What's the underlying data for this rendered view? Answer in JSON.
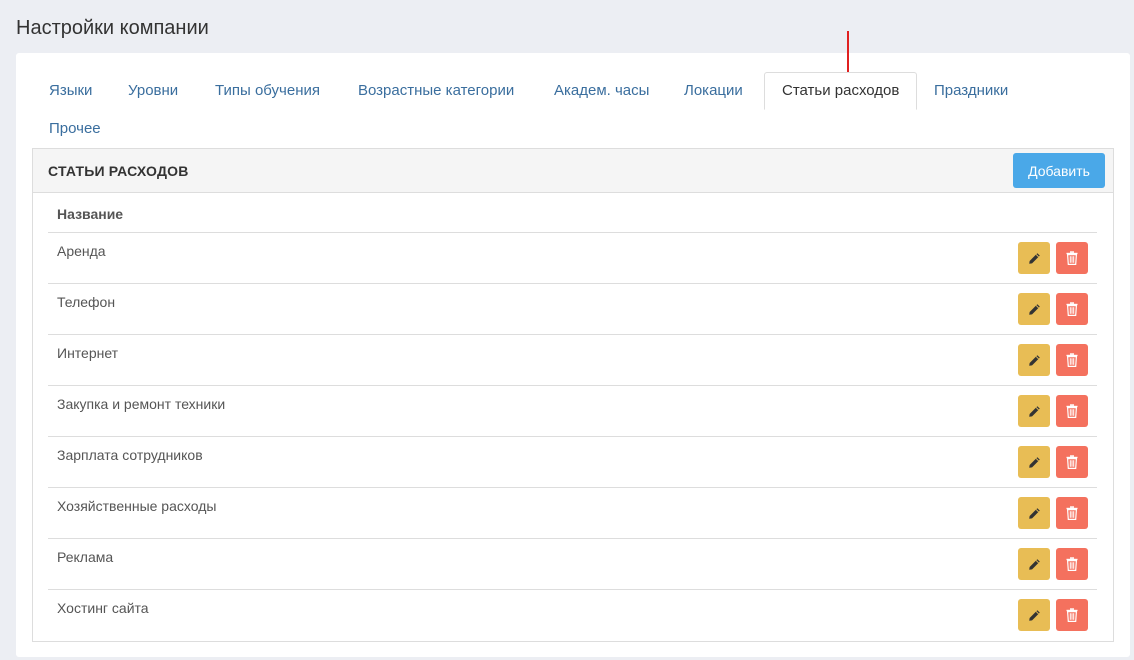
{
  "page": {
    "title": "Настройки компании"
  },
  "tabs": [
    {
      "label": "Языки",
      "active": false
    },
    {
      "label": "Уровни",
      "active": false
    },
    {
      "label": "Типы обучения",
      "active": false
    },
    {
      "label": "Возрастные категории",
      "active": false
    },
    {
      "label": "Академ. часы",
      "active": false
    },
    {
      "label": "Локации",
      "active": false
    },
    {
      "label": "Статьи расходов",
      "active": true
    },
    {
      "label": "Праздники",
      "active": false
    },
    {
      "label": "Прочее",
      "active": false
    }
  ],
  "panel": {
    "title": "СТАТЬИ РАСХОДОВ",
    "add_label": "Добавить",
    "column_header": "Название",
    "rows": [
      {
        "name": "Аренда"
      },
      {
        "name": "Телефон"
      },
      {
        "name": "Интернет"
      },
      {
        "name": "Закупка и ремонт техники"
      },
      {
        "name": "Зарплата сотрудников"
      },
      {
        "name": "Хозяйственные расходы"
      },
      {
        "name": "Реклама"
      },
      {
        "name": "Хостинг сайта"
      }
    ]
  },
  "colors": {
    "add_button": "#4aa8e8",
    "edit_button": "#e8bd55",
    "delete_button": "#f4715e",
    "tab_link": "#3a6e9e",
    "annotation_arrow": "#e02020"
  },
  "icons": {
    "edit": "pencil-icon",
    "delete": "trash-icon"
  }
}
